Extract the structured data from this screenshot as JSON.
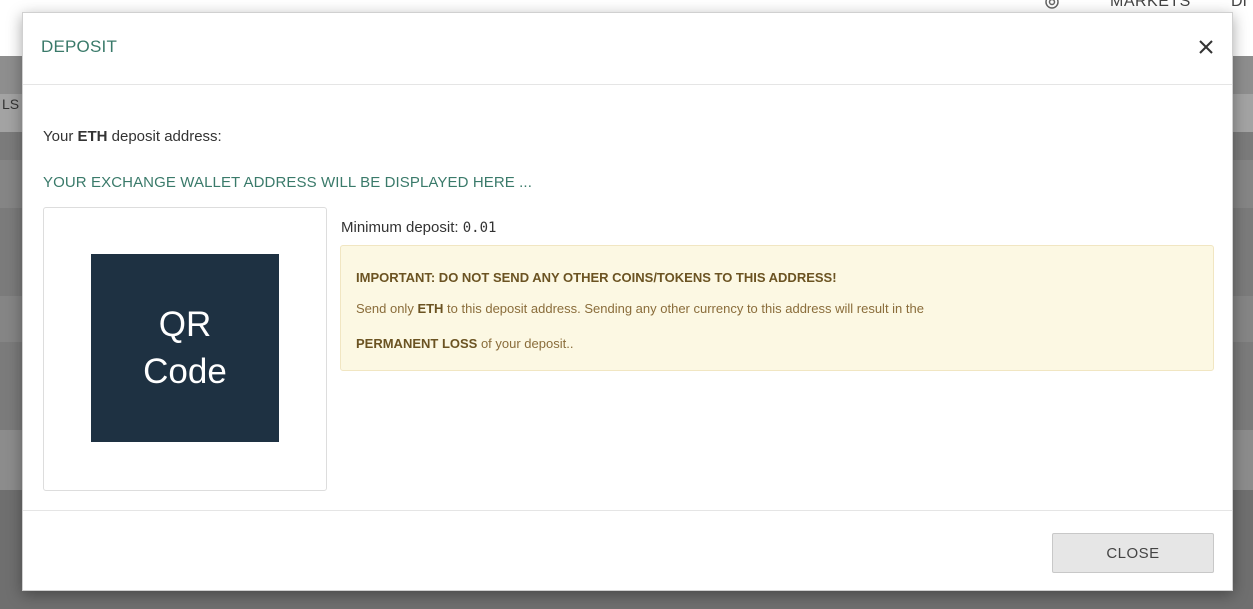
{
  "background": {
    "nav_markets": "MARKETS",
    "nav_partial": "DI",
    "column_label": "LS"
  },
  "modal": {
    "title": "DEPOSIT",
    "address_prefix": "Your ",
    "currency": "ETH",
    "address_suffix": " deposit address:",
    "address_placeholder": "YOUR EXCHANGE WALLET ADDRESS WILL BE DISPLAYED HERE ...",
    "qr_line1": "QR",
    "qr_line2": "Code",
    "min_deposit_label": "Minimum deposit: ",
    "min_deposit_value": "0.01",
    "alert": {
      "title": "IMPORTANT: DO NOT SEND ANY OTHER COINS/TOKENS TO THIS ADDRESS!",
      "line1_prefix": "Send only ",
      "line1_currency": "ETH",
      "line1_suffix": " to this deposit address. Sending any other currency to this address will result in the",
      "line2_bold": "PERMANENT LOSS",
      "line2_suffix": " of your deposit.."
    },
    "close_button": "CLOSE"
  },
  "colors": {
    "accent_green": "#3a7a6a",
    "qr_background": "#1e3142",
    "alert_background": "#fcf8e3"
  },
  "icons": {
    "close": "close-icon",
    "settings": "gear-icon"
  }
}
